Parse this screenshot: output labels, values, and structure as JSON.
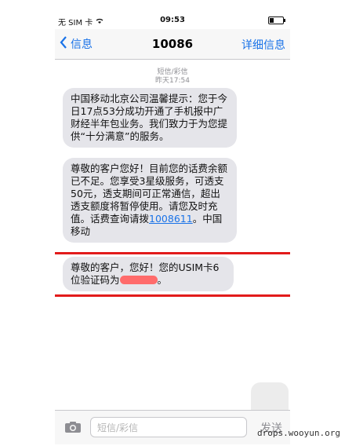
{
  "status": {
    "carrier": "无 SIM 卡",
    "time": "09:53"
  },
  "nav": {
    "back_label": "信息",
    "title": "10086",
    "detail_label": "详细信息"
  },
  "thread": {
    "type_label": "短信/彩信",
    "date_label": "昨天17:54"
  },
  "messages": [
    {
      "text": "中国移动北京公司温馨提示：您于今日17点53分成功开通了手机报中广财经半年包业务。我们致力于为您提供“十分满意”的服务。"
    },
    {
      "text_before_link": "尊敬的客户您好！目前您的话费余额已不足。您享受3星级服务，可透支50元，透支期间可正常通信，超出透支额度将暂停使用。请您及时充值。话费查询请拨",
      "link": "1008611",
      "text_after_link": "。中国移动"
    },
    {
      "text_before_code": "尊敬的客户，您好！您的USIM卡6位验证码为",
      "text_after_code": "。"
    }
  ],
  "input": {
    "placeholder": "短信/彩信",
    "send_label": "发送"
  },
  "watermark": "drops.wooyun.org",
  "colors": {
    "accent": "#1a73e8",
    "bubble": "#e5e5ea",
    "highlight_border": "#e21b1b",
    "redaction": "#ff6b6b"
  }
}
